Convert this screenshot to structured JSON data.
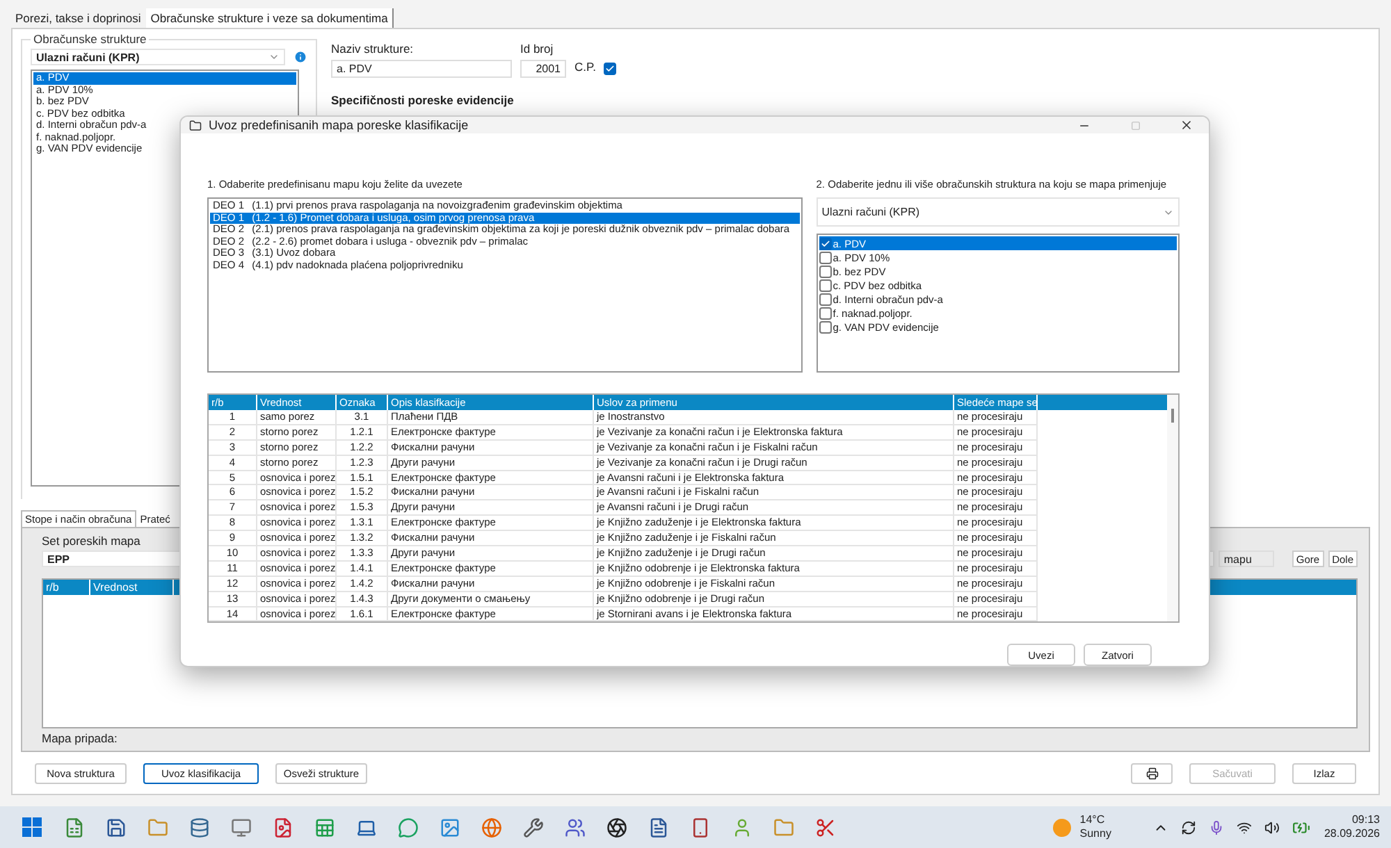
{
  "main_tabs": [
    {
      "label": "Porezi, takse i doprinosi",
      "selected": false
    },
    {
      "label": "Obračunske strukture i veze sa dokumentima",
      "selected": true
    }
  ],
  "structures": {
    "title": "Obračunske strukture",
    "dropdown": "Ulazni računi (KPR)",
    "items": [
      {
        "label": "a. PDV",
        "selected": true
      },
      {
        "label": "a. PDV 10%",
        "selected": false
      },
      {
        "label": "b. bez PDV",
        "selected": false
      },
      {
        "label": "c. PDV bez odbitka",
        "selected": false
      },
      {
        "label": "d. Interni obračun pdv-a",
        "selected": false
      },
      {
        "label": "f. naknad.poljopr.",
        "selected": false
      },
      {
        "label": "g. VAN PDV evidencije",
        "selected": false
      }
    ]
  },
  "details": {
    "name_label": "Naziv strukture:",
    "name_value": "a. PDV",
    "id_label": "Id broj",
    "id_value": "2001",
    "cp_label": "C.P.",
    "cp_checked": true,
    "section_title": "Specifičnosti poreske evidencije"
  },
  "lower": {
    "tabs": [
      {
        "label": "Stope i način obračuna",
        "selected": true
      },
      {
        "label": "Prateć",
        "selected": false
      }
    ],
    "set_label": "Set poreskih mapa",
    "set_value": "EPP",
    "columns": [
      "r/b",
      "Vrednost"
    ],
    "map_field": "mapu",
    "buttons": [
      "Gore",
      "Dole"
    ],
    "owner_label": "Mapa pripada:"
  },
  "footer": {
    "left": [
      {
        "label": "Nova struktura",
        "focused": false
      },
      {
        "label": "Uvoz klasifikacija",
        "focused": true
      },
      {
        "label": "Osveži strukture",
        "focused": false
      }
    ],
    "right": [
      {
        "label": "Sačuvati",
        "disabled": true
      },
      {
        "label": "Izlaz",
        "disabled": false
      }
    ]
  },
  "dialog": {
    "title": "Uvoz predefinisanih mapa poreske klasifikacije",
    "step1_label": "1. Odaberite predefinisanu mapu koju želite da uvezete",
    "maps": [
      {
        "part": "DEO 1",
        "text": "(1.1) prvi prenos prava raspolaganja na novoizgrađenim građevinskim objektima",
        "selected": false
      },
      {
        "part": "DEO 1",
        "text": "(1.2 - 1.6) Promet dobara i usluga, osim prvog prenosa prava",
        "selected": true
      },
      {
        "part": "DEO 2",
        "text": "(2.1) prenos prava raspolaganja na građevinskim objektima za koji je poreski dužnik obveznik pdv – primalac dobara",
        "selected": false
      },
      {
        "part": "DEO 2",
        "text": "(2.2 - 2.6) promet dobara i usluga - obveznik pdv – primalac",
        "selected": false
      },
      {
        "part": "DEO 3",
        "text": "(3.1) Uvoz dobara",
        "selected": false
      },
      {
        "part": "DEO 4",
        "text": "(4.1) pdv nadoknada plaćena poljoprivredniku",
        "selected": false
      }
    ],
    "step2_label": "2. Odaberite jednu ili više obračunskih struktura na koju se mapa primenjuje",
    "step2_dropdown": "Ulazni računi (KPR)",
    "targets": [
      {
        "label": "a. PDV",
        "checked": true,
        "selected": true
      },
      {
        "label": "a. PDV 10%",
        "checked": false,
        "selected": false
      },
      {
        "label": "b. bez PDV",
        "checked": false,
        "selected": false
      },
      {
        "label": "c. PDV bez odbitka",
        "checked": false,
        "selected": false
      },
      {
        "label": "d. Interni obračun pdv-a",
        "checked": false,
        "selected": false
      },
      {
        "label": "f. naknad.poljopr.",
        "checked": false,
        "selected": false
      },
      {
        "label": "g. VAN PDV evidencije",
        "checked": false,
        "selected": false
      }
    ],
    "table": {
      "columns": [
        "r/b",
        "Vrednost",
        "Oznaka",
        "Opis klasifkacije",
        "Uslov za primenu",
        "Sledeće mape se"
      ],
      "rows": [
        [
          "1",
          "samo porez",
          "3.1",
          "Плаћени ПДВ",
          "je Inostranstvo",
          "ne procesiraju"
        ],
        [
          "2",
          "storno porez",
          "1.2.1",
          "Електронске фактуре",
          "je Vezivanje za konačni račun i  je Elektronska faktura",
          "ne procesiraju"
        ],
        [
          "3",
          "storno porez",
          "1.2.2",
          "Фискални рачуни",
          "je Vezivanje za konačni račun i  je Fiskalni račun",
          "ne procesiraju"
        ],
        [
          "4",
          "storno porez",
          "1.2.3",
          "Други рачуни",
          "je Vezivanje za konačni račun i  je Drugi račun",
          "ne procesiraju"
        ],
        [
          "5",
          "osnovica i porez",
          "1.5.1",
          "Електронске фактуре",
          "je Avansni računi i  je Elektronska faktura",
          "ne procesiraju"
        ],
        [
          "6",
          "osnovica i porez",
          "1.5.2",
          "Фискални рачуни",
          "je Avansni računi i  je Fiskalni račun",
          "ne procesiraju"
        ],
        [
          "7",
          "osnovica i porez",
          "1.5.3",
          "Други рачуни",
          "je Avansni računi i  je Drugi račun",
          "ne procesiraju"
        ],
        [
          "8",
          "osnovica i porez",
          "1.3.1",
          "Електронске фактуре",
          "je Knjižno zaduženje i  je Elektronska faktura",
          "ne procesiraju"
        ],
        [
          "9",
          "osnovica i porez",
          "1.3.2",
          "Фискални рачуни",
          "je Knjižno zaduženje i  je Fiskalni račun",
          "ne procesiraju"
        ],
        [
          "10",
          "osnovica i porez",
          "1.3.3",
          "Други рачуни",
          "je Knjižno zaduženje i  je Drugi račun",
          "ne procesiraju"
        ],
        [
          "11",
          "osnovica i porez",
          "1.4.1",
          "Електронске фактуре",
          "je Knjižno odobrenje i  je Elektronska faktura",
          "ne procesiraju"
        ],
        [
          "12",
          "osnovica i porez",
          "1.4.2",
          "Фискални рачуни",
          "je Knjižno odobrenje i  je Fiskalni račun",
          "ne procesiraju"
        ],
        [
          "13",
          "osnovica i porez",
          "1.4.3",
          "Други документи о смањењу",
          "je Knjižno odobrenje i  je Drugi račun",
          "ne procesiraju"
        ],
        [
          "14",
          "osnovica i porez",
          "1.6.1",
          "Електронске фактуре",
          "je Stornirani avans i  je Elektronska faktura",
          "ne procesiraju"
        ]
      ]
    },
    "buttons": [
      "Uvezi",
      "Zatvori"
    ]
  },
  "taskbar": {
    "temperature": "14°C",
    "weather": "Sunny",
    "time": "09:13",
    "date": "28.09.2026"
  }
}
